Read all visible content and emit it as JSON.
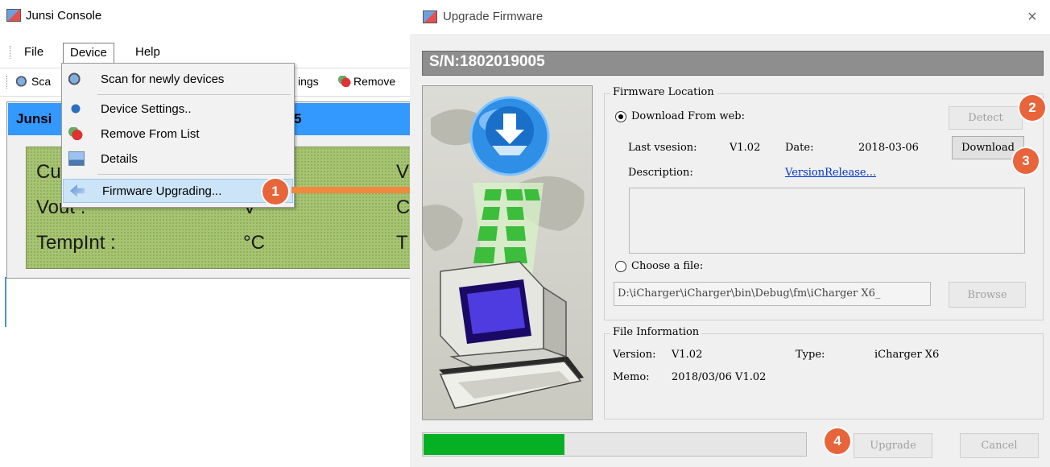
{
  "console": {
    "title": "Junsi Console",
    "menu": {
      "file": "File",
      "device": "Device",
      "help": "Help"
    },
    "toolbar": {
      "scan": "Sca",
      "settings": "ings",
      "remove": "Remove"
    },
    "device_name": "Junsi",
    "device_sn_suffix": "5",
    "lcd": {
      "cu": "Cu",
      "v": "V",
      "vout": "Vout :",
      "vout_unit": "V",
      "c": "C",
      "tempint": "TempInt  :",
      "temp_unit": "°C",
      "t": "T"
    },
    "device_menu": {
      "items": [
        {
          "label": "Scan for newly devices",
          "icon": "scan-icon"
        },
        {
          "label": "Device Settings..",
          "icon": "settings-icon"
        },
        {
          "label": "Remove From List",
          "icon": "remove-icon"
        },
        {
          "label": "Details",
          "icon": "details-icon"
        },
        {
          "label": "Firmware Upgrading...",
          "icon": "firmware-icon",
          "highlighted": true
        }
      ]
    }
  },
  "dialog": {
    "title": "Upgrade Firmware",
    "close_glyph": "×",
    "sn": "S/N:1802019005",
    "firmware_location": {
      "label": "Firmware Location",
      "download_from_web": "Download From web:",
      "detect_button": "Detect",
      "last_version_label": "Last vsesion:",
      "last_version": "V1.02",
      "date_label": "Date:",
      "date": "2018-03-06",
      "download_button": "Download",
      "description_label": "Description:",
      "description_link": "VersionRelease...",
      "choose_file": "Choose a file:",
      "file_path": "D:\\iCharger\\iCharger\\bin\\Debug\\fm\\iCharger X6_",
      "browse_button": "Browse",
      "selected_option": "download_from_web"
    },
    "file_information": {
      "label": "File Information",
      "version_label": "Version:",
      "version": "V1.02",
      "type_label": "Type:",
      "type": "iCharger X6",
      "memo_label": "Memo:",
      "memo": "2018/03/06 V1.02"
    },
    "progress_fraction": 0.37,
    "upgrade_button": "Upgrade",
    "cancel_button": "Cancel"
  },
  "badges": [
    "1",
    "2",
    "3",
    "4"
  ],
  "colors": {
    "badge": "#e8643a",
    "arrow": "#f0883e",
    "progress": "#06b025",
    "selection": "#3399ff",
    "lcd": "#a7c473"
  }
}
